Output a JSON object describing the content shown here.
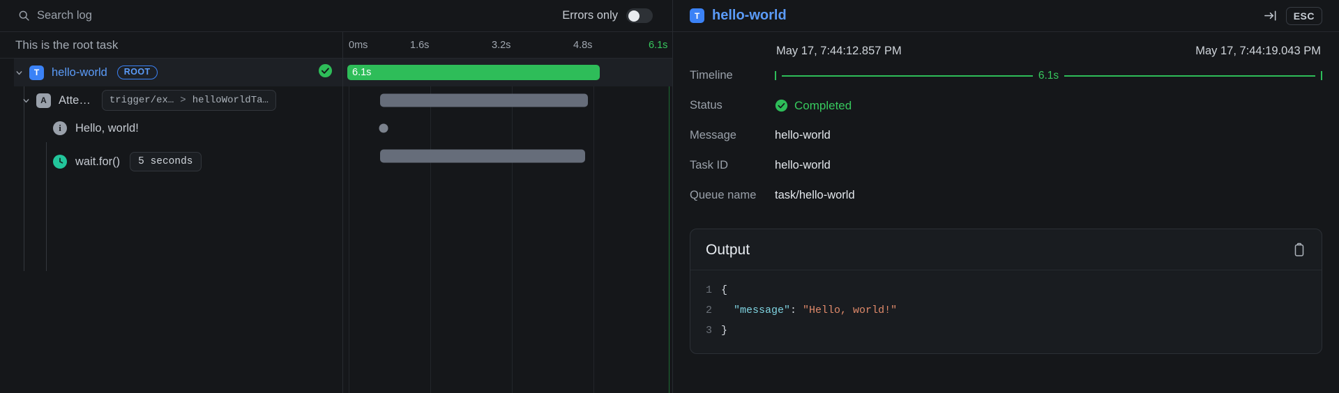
{
  "search": {
    "placeholder": "Search log",
    "value": "",
    "icon": "search-icon"
  },
  "filters": {
    "errors_only_label": "Errors only",
    "errors_only_enabled": false
  },
  "tree_header": {
    "caption": "This is the root task"
  },
  "timeline_axis": {
    "ticks": [
      {
        "label": "0ms",
        "pos_pct": 0
      },
      {
        "label": "1.6s",
        "pos_pct": 25
      },
      {
        "label": "3.2s",
        "pos_pct": 50
      },
      {
        "label": "4.8s",
        "pos_pct": 75
      },
      {
        "label": "6.1s",
        "pos_pct": 100
      }
    ],
    "end_color": "#37c95e"
  },
  "tree_rows": [
    {
      "type": "task",
      "badge": "T",
      "title": "hello-world",
      "tag": "ROOT",
      "status_icon": "check-circle-icon",
      "selected": true
    },
    {
      "type": "attempt",
      "badge": "A",
      "title": "Atte…",
      "path_left": "trigger/ex…",
      "path_sep": ">",
      "path_right": "helloWorldTa…"
    },
    {
      "type": "log",
      "icon": "info-icon",
      "title": "Hello, world!"
    },
    {
      "type": "wait",
      "icon": "clock-icon",
      "title": "wait.for()",
      "chip": "5 seconds"
    }
  ],
  "timeline_bars": [
    {
      "kind": "bar",
      "color": "#2ebd59",
      "label": "6.1s",
      "start_pct": 0,
      "width_pct": 100
    },
    {
      "kind": "bar",
      "color": "#666d7a",
      "label": "",
      "start_pct": 12.6,
      "width_pct": 82.2
    },
    {
      "kind": "dot",
      "color": "#7b828d",
      "label": "",
      "start_pct": 13.1,
      "width_pct": 0
    },
    {
      "kind": "bar",
      "color": "#666d7a",
      "label": "",
      "start_pct": 12.6,
      "width_pct": 81.7
    }
  ],
  "detail": {
    "badge": "T",
    "title": "hello-world",
    "esc_label": "ESC",
    "collapse_icon": "collapse-right-icon",
    "timeline": {
      "label": "Timeline",
      "start": "May 17, 7:44:12.857 PM",
      "end": "May 17, 7:44:19.043 PM",
      "duration": "6.1s"
    },
    "rows": [
      {
        "label": "Status",
        "value": "Completed",
        "icon": "check-circle-icon",
        "accent": "#37c95e"
      },
      {
        "label": "Message",
        "value": "hello-world"
      },
      {
        "label": "Task ID",
        "value": "hello-world"
      },
      {
        "label": "Queue name",
        "value": "task/hello-world"
      }
    ],
    "output": {
      "title": "Output",
      "copy_icon": "clipboard-icon",
      "lines": [
        {
          "n": "1",
          "parts": [
            {
              "t": "punc",
              "v": "{"
            }
          ]
        },
        {
          "n": "2",
          "parts": [
            {
              "t": "punc",
              "v": "  "
            },
            {
              "t": "key",
              "v": "\"message\""
            },
            {
              "t": "punc",
              "v": ": "
            },
            {
              "t": "str",
              "v": "\"Hello, world!\""
            }
          ]
        },
        {
          "n": "3",
          "parts": [
            {
              "t": "punc",
              "v": "}"
            }
          ]
        }
      ]
    }
  }
}
